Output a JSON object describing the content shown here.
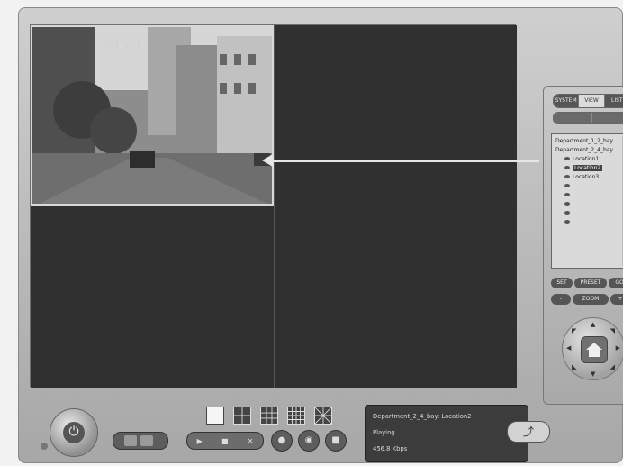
{
  "video_overlay_text": "ed vid",
  "panel": {
    "tabs": [
      "SYSTEM",
      "VIEW",
      "LIST"
    ],
    "tree": {
      "items": [
        "Department_1_2_bay",
        "Department_2_4_bay",
        "Location1",
        "Location2",
        "Location3",
        "",
        "",
        "",
        "",
        ""
      ]
    },
    "preset_row": [
      "SET",
      "PRESET",
      "GO"
    ],
    "zoom_row": [
      "-",
      "ZOOM",
      "+"
    ]
  },
  "transport": {
    "play_symbol": "▶",
    "stop_symbol": "■",
    "close_symbol": "✕"
  },
  "status": {
    "line1": "Department_2_4_bay: Location2",
    "line2": "Playing",
    "line3": "456.8 Kbps"
  },
  "icons": {
    "power": "⏻",
    "export": "⤴"
  }
}
